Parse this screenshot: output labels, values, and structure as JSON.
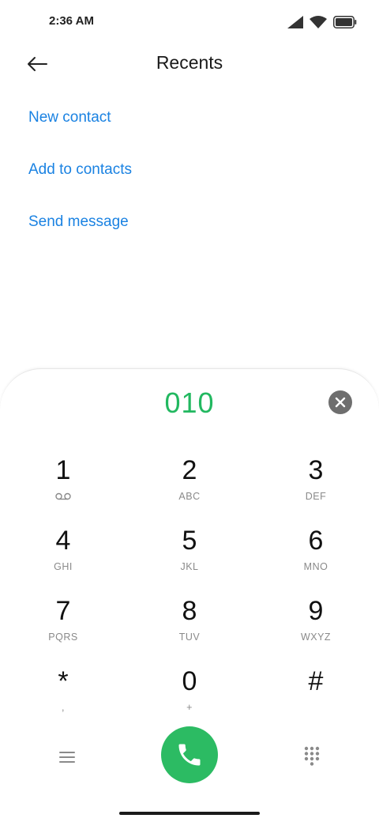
{
  "status_bar": {
    "time": "2:36 AM"
  },
  "header": {
    "title": "Recents"
  },
  "actions": [
    {
      "label": "New contact"
    },
    {
      "label": "Add to contacts"
    },
    {
      "label": "Send message"
    }
  ],
  "dialer": {
    "number": "010",
    "keys": [
      {
        "digit": "1",
        "letters": "",
        "sub_icon": "voicemail-icon"
      },
      {
        "digit": "2",
        "letters": "ABC"
      },
      {
        "digit": "3",
        "letters": "DEF"
      },
      {
        "digit": "4",
        "letters": "GHI"
      },
      {
        "digit": "5",
        "letters": "JKL"
      },
      {
        "digit": "6",
        "letters": "MNO"
      },
      {
        "digit": "7",
        "letters": "PQRS"
      },
      {
        "digit": "8",
        "letters": "TUV"
      },
      {
        "digit": "9",
        "letters": "WXYZ"
      },
      {
        "digit": "*",
        "letters": ","
      },
      {
        "digit": "0",
        "letters": "+"
      },
      {
        "digit": "#",
        "letters": ""
      }
    ]
  },
  "colors": {
    "accent_blue": "#1a82e2",
    "number_green": "#22b860",
    "call_green": "#2cbb63"
  }
}
